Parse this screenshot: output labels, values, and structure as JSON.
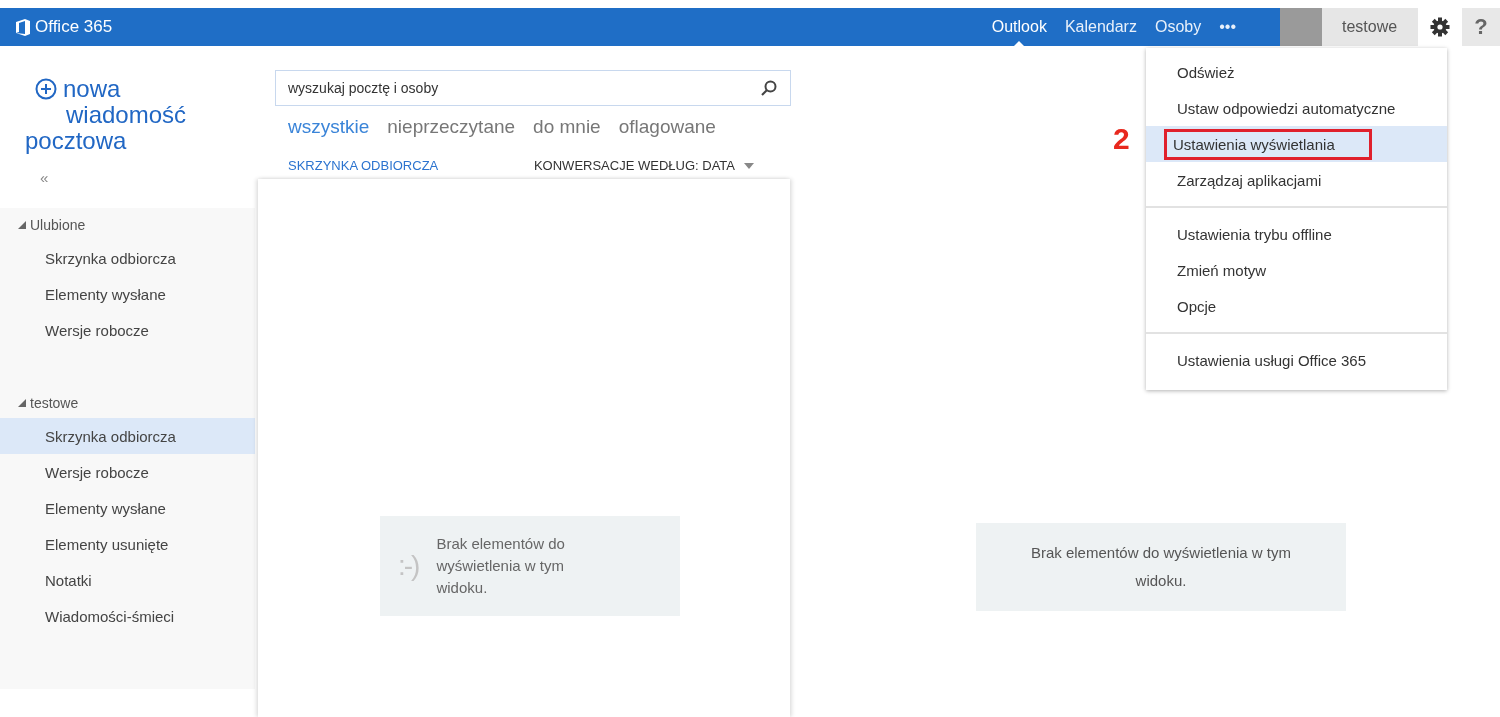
{
  "header": {
    "logo": "Office 365",
    "nav": [
      {
        "label": "Outlook",
        "selected": true
      },
      {
        "label": "Kalendarz",
        "selected": false
      },
      {
        "label": "Osoby",
        "selected": false
      },
      {
        "label": "•••",
        "selected": false
      }
    ],
    "user": "testowe",
    "help": "?"
  },
  "compose": {
    "line1": "nowa",
    "line2": "wiadomość",
    "line3": "pocztowa",
    "collapse": "«"
  },
  "folders": [
    {
      "label": "Ulubione",
      "expanded": true,
      "children": [
        {
          "label": "Skrzynka odbiorcza",
          "selected": false
        },
        {
          "label": "Elementy wysłane",
          "selected": false
        },
        {
          "label": "Wersje robocze",
          "selected": false
        }
      ]
    },
    {
      "label": "testowe",
      "expanded": true,
      "children": [
        {
          "label": "Skrzynka odbiorcza",
          "selected": true
        },
        {
          "label": "Wersje robocze",
          "selected": false
        },
        {
          "label": "Elementy wysłane",
          "selected": false
        },
        {
          "label": "Elementy usunięte",
          "selected": false
        },
        {
          "label": "Notatki",
          "selected": false
        },
        {
          "label": "Wiadomości-śmieci",
          "selected": false
        }
      ]
    }
  ],
  "search": {
    "placeholder": "wyszukaj pocztę i osoby"
  },
  "filters": [
    {
      "label": "wszystkie",
      "selected": true
    },
    {
      "label": "nieprzeczytane",
      "selected": false
    },
    {
      "label": "do mnie",
      "selected": false
    },
    {
      "label": "oflagowane",
      "selected": false
    }
  ],
  "list": {
    "folder": "SKRZYNKA ODBIORCZA",
    "sort": "KONWERSACJE WEDŁUG: DATA",
    "empty_emoticon": ":-)",
    "empty_text": "Brak elementów do wyświetlenia w tym widoku."
  },
  "reading_pane": {
    "empty_text": "Brak elementów do wyświetlenia w tym widoku."
  },
  "settings_menu": {
    "groups": [
      [
        {
          "label": "Odśwież",
          "selected": false,
          "outlined": false
        },
        {
          "label": "Ustaw odpowiedzi automatyczne",
          "selected": false,
          "outlined": false
        },
        {
          "label": "Ustawienia wyświetlania",
          "selected": true,
          "outlined": true
        },
        {
          "label": "Zarządzaj aplikacjami",
          "selected": false,
          "outlined": false
        }
      ],
      [
        {
          "label": "Ustawienia trybu offline",
          "selected": false,
          "outlined": false
        },
        {
          "label": "Zmień motyw",
          "selected": false,
          "outlined": false
        },
        {
          "label": "Opcje",
          "selected": false,
          "outlined": false
        }
      ],
      [
        {
          "label": "Ustawienia usługi Office 365",
          "selected": false,
          "outlined": false
        }
      ]
    ]
  },
  "annotation": {
    "label": "2"
  }
}
